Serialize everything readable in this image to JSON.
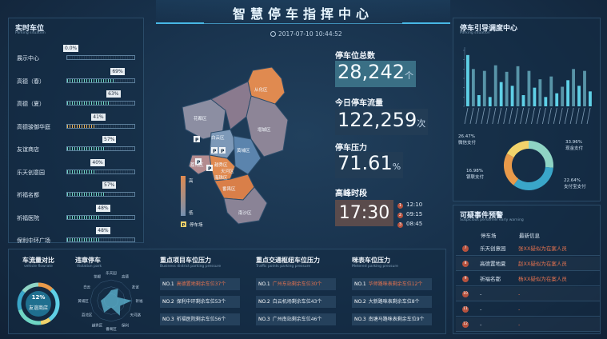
{
  "header": {
    "title": "智慧停车指挥中心",
    "datetime": "2017-07-10 10:44:52"
  },
  "occupancy": {
    "title": "实时车位",
    "subtitle": "Parking situation",
    "rows": [
      {
        "label": "展示中心",
        "pct": "0.0%",
        "value": 0.0
      },
      {
        "label": "高德（春）",
        "pct": "69%",
        "value": 69
      },
      {
        "label": "高德（夏）",
        "pct": "63%",
        "value": 63
      },
      {
        "label": "高德骏御华庭",
        "pct": "41%",
        "value": 41
      },
      {
        "label": "友谊商店",
        "pct": "57%",
        "value": 57
      },
      {
        "label": "乐天创意园",
        "pct": "40%",
        "value": 40
      },
      {
        "label": "祈福名都",
        "pct": "57%",
        "value": 57
      },
      {
        "label": "祈福医院",
        "pct": "48%",
        "value": 48
      },
      {
        "label": "保利中环广场",
        "pct": "48%",
        "value": 48
      }
    ]
  },
  "map": {
    "districts": [
      "从化区",
      "花都区",
      "白云区",
      "增城区",
      "黄埔区",
      "越秀区",
      "天河区",
      "番禺区",
      "荔湾区",
      "海珠区",
      "南沙区"
    ],
    "legend_high": "高",
    "legend_low": "低",
    "legend_parking": "停车场",
    "parking_marker": "P"
  },
  "stats": {
    "total_label": "停车位总数",
    "total_value": "28,242",
    "total_unit": "个",
    "flow_label": "今日停车流量",
    "flow_value": "122,259",
    "flow_unit": "次",
    "pressure_label": "停车压力",
    "pressure_value": "71.61",
    "pressure_unit": "%",
    "peak_label": "高峰时段",
    "peak_value": "17:30",
    "peak_list": [
      {
        "n": "1",
        "time": "12:10"
      },
      {
        "n": "2",
        "time": "09:15"
      },
      {
        "n": "3",
        "time": "08:45"
      }
    ]
  },
  "guide": {
    "title": "停车引导调度中心",
    "subtitle": "Parking situation",
    "chart_data": {
      "type": "bar",
      "categories": [
        "A1",
        "A2",
        "A3",
        "A4",
        "A5",
        "A6",
        "A7",
        "A8",
        "A9",
        "A10",
        "A11",
        "A12",
        "A13",
        "A14",
        "A15",
        "A16",
        "A17",
        "A18",
        "A19",
        "A20",
        "A21",
        "A22",
        "A23"
      ],
      "series": [
        {
          "values": [
            55,
            40,
            12,
            38,
            10,
            44,
            26,
            37,
            22,
            43,
            12,
            38,
            20,
            29,
            10,
            32,
            14,
            21,
            28,
            40,
            22,
            38,
            16
          ]
        }
      ],
      "ylim": [
        0,
        60
      ]
    },
    "donut": {
      "chart_data": {
        "type": "pie",
        "slices": [
          {
            "pct": "26.47%",
            "value": 26.47,
            "label": "微信支付",
            "color": "#8fd4c4"
          },
          {
            "pct": "33.96%",
            "value": 33.96,
            "label": "现金支付",
            "color": "#3aa6c9"
          },
          {
            "pct": "22.64%",
            "value": 22.64,
            "label": "支付宝支付",
            "color": "#e99a4a"
          },
          {
            "pct": "16.98%",
            "value": 16.98,
            "label": "银联支付",
            "color": "#f1d36b"
          }
        ]
      }
    }
  },
  "warning": {
    "title": "可疑事件预警",
    "subtitle": "Suspicious personnel early warning",
    "head_lot": "停车场",
    "head_info": "最新信息",
    "rows": [
      {
        "n": "7",
        "lot": "乐天创意园",
        "info": "张XX疑似为在案人员"
      },
      {
        "n": "8",
        "lot": "高德置地夏",
        "info": "赵XX疑似为在案人员"
      },
      {
        "n": "9",
        "lot": "祈福名都",
        "info": "杨XX疑似为在案人员"
      },
      {
        "n": "10",
        "lot": "-",
        "info": "-"
      },
      {
        "n": "11",
        "lot": "-",
        "info": "-"
      },
      {
        "n": "12",
        "lot": "-",
        "info": "-"
      }
    ]
  },
  "bottom": {
    "flow_title": "车流量对比",
    "flow_sub": "vehicle flowrate",
    "ring_pct": "12%",
    "ring_label": "友谊商店",
    "ring_value": 12,
    "violation_title": "违章停车",
    "violation_sub": "Violation park",
    "radar_labels": [
      "乐天园",
      "高德",
      "友谊",
      "祈福",
      "天河路",
      "保利",
      "番禺区",
      "越秀区",
      "荔湾区",
      "黄埔区",
      "白云",
      "花都"
    ],
    "radar_chart_data": {
      "type": "radar",
      "values": [
        3,
        4,
        2,
        6,
        3,
        5,
        2,
        4,
        3,
        3,
        2,
        2
      ]
    },
    "business": {
      "title": "重点项目车位压力",
      "sub": "Business district parking pressure",
      "rows": [
        {
          "no": "NO.1",
          "text": "高德置地剩余车位37个"
        },
        {
          "no": "NO.2",
          "text": "保利中环剩余车位53个"
        },
        {
          "no": "NO.3",
          "text": "祈福医院剩余车位56个"
        }
      ]
    },
    "traffic": {
      "title": "重点交通枢纽车位压力",
      "sub": "Traffic points parking pressure",
      "rows": [
        {
          "no": "NO.1",
          "text": "广州东站剩余车位30个"
        },
        {
          "no": "NO.2",
          "text": "白云机场剩余车位43个"
        },
        {
          "no": "NO.3",
          "text": "广州南站剩余车位46个"
        }
      ]
    },
    "metered": {
      "title": "咪表车位压力",
      "sub": "Metered parking pressure",
      "rows": [
        {
          "no": "NO.1",
          "text": "华师路咪表剩余车位12个"
        },
        {
          "no": "NO.2",
          "text": "大新路咪表剩余车位8个"
        },
        {
          "no": "NO.3",
          "text": "南塘马路咪表剩余车位9个"
        }
      ]
    }
  }
}
